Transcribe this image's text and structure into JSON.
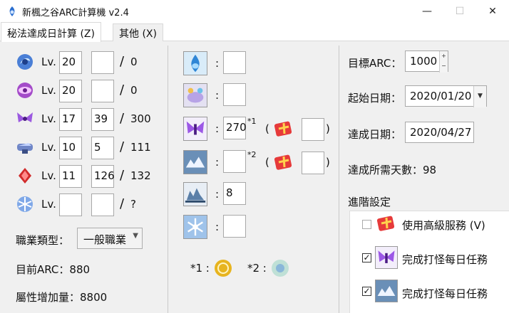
{
  "window": {
    "title": "新楓之谷ARC計算機  v2.4",
    "min_glyph": "—",
    "max_glyph": "☐",
    "close_glyph": "✕"
  },
  "tabs": [
    {
      "label": "秘法達成日計算 (Z)",
      "active": true
    },
    {
      "label": "其他 (X)",
      "active": false
    }
  ],
  "symbols": [
    {
      "lv_label": "Lv.",
      "level": "20",
      "current": "",
      "max": "0",
      "icon": "vanishing-journey-symbol-icon"
    },
    {
      "lv_label": "Lv.",
      "level": "20",
      "current": "",
      "max": "0",
      "icon": "chu-chu-island-symbol-icon"
    },
    {
      "lv_label": "Lv.",
      "level": "17",
      "current": "39",
      "max": "300",
      "icon": "lachelein-symbol-icon"
    },
    {
      "lv_label": "Lv.",
      "level": "10",
      "current": "5",
      "max": "111",
      "icon": "arcana-symbol-icon"
    },
    {
      "lv_label": "Lv.",
      "level": "11",
      "current": "126",
      "max": "132",
      "icon": "morass-symbol-icon"
    },
    {
      "lv_label": "Lv.",
      "level": "",
      "current": "",
      "max": "?",
      "icon": "esfera-symbol-icon"
    }
  ],
  "job": {
    "label": "職業類型：",
    "selected": "一般職業"
  },
  "arc": {
    "label": "目前ARC：",
    "value": "880"
  },
  "stat": {
    "label": "屬性增加量：",
    "value": "8800"
  },
  "daily": [
    {
      "icon": "vanishing-journey-daily-icon",
      "value": "",
      "mark": ""
    },
    {
      "icon": "chu-chu-daily-icon",
      "value": "",
      "mark": ""
    },
    {
      "icon": "lachelein-daily-icon",
      "value": "270",
      "mark": "*1"
    },
    {
      "icon": "arcana-daily-icon",
      "value": "",
      "mark": "*2"
    },
    {
      "icon": "morass-daily-icon",
      "value": "8",
      "mark": ""
    },
    {
      "icon": "esfera-daily-icon",
      "value": "",
      "mark": ""
    }
  ],
  "colon": ":",
  "extra_open": "(",
  "extra_close": ")",
  "legend": {
    "one": "*1 :",
    "two": "*2 :"
  },
  "target_arc": {
    "label": "目標ARC：",
    "value": "1000"
  },
  "start_date": {
    "label": "起始日期：",
    "value": "2020/01/20"
  },
  "done_date": {
    "label": "達成日期：",
    "value": "2020/04/27"
  },
  "days_needed": {
    "label": "達成所需天數：",
    "value": "98"
  },
  "advanced": {
    "title": "進階設定",
    "options": [
      {
        "label": "使用高級服務 (V)",
        "checked": false
      },
      {
        "label": "完成打怪每日任務",
        "checked": true
      },
      {
        "label": "完成打怪每日任務",
        "checked": true
      }
    ]
  },
  "colors": {
    "accent": "#1e6fd9",
    "panel": "#f0f0f0"
  }
}
